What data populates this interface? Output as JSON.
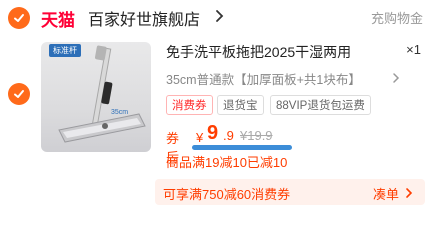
{
  "colors": {
    "accent": "#ff6a1a",
    "tmall": "#ff0036",
    "price": "#ff3d00",
    "underline": "#3c8dd8"
  },
  "store": {
    "logo": "天猫",
    "name": "百家好世旗舰店",
    "recharge_label": "充购物金"
  },
  "item": {
    "image_badge": "标准杆",
    "title": "免手洗平板拖把2025干湿两用",
    "quantity": "×1",
    "sku": "35cm普通款【加厚面板+共1块布】",
    "tags": [
      "消费券",
      "退货宝",
      "88VIP退货包运费"
    ],
    "price": {
      "after_label": "券后",
      "currency": "¥",
      "integer": "9",
      "decimal": ".9",
      "original": "¥19.9"
    },
    "promo": "商品满19减10已减10"
  },
  "bottom": {
    "offer": "可享满750减60消费券",
    "action": "凑单"
  },
  "icons": {
    "store_check": "check-icon",
    "item_check": "check-icon",
    "chevrons": "chevron-right-icon"
  }
}
